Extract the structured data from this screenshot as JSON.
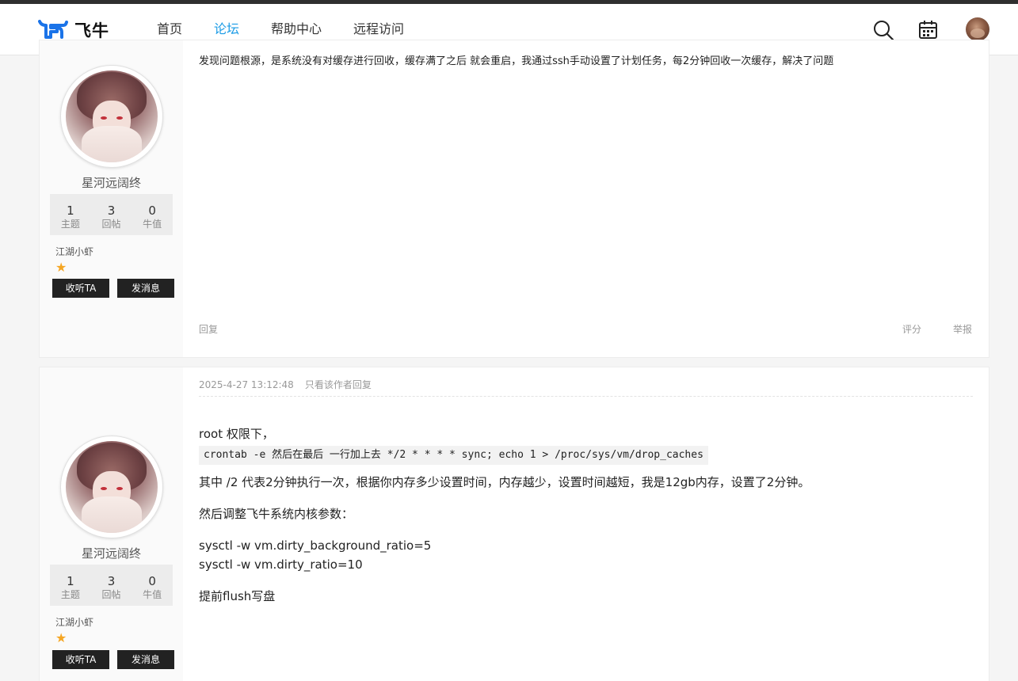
{
  "header": {
    "logo_text": "飞牛",
    "nav": [
      "首页",
      "论坛",
      "帮助中心",
      "远程访问"
    ],
    "active_nav": "论坛",
    "accent_color": "#1a9be6",
    "icons": [
      "search-icon",
      "calendar-icon",
      "user-avatar"
    ]
  },
  "posts": [
    {
      "author": {
        "name": "星河远阔终",
        "stats": [
          {
            "value": "1",
            "label": "主题"
          },
          {
            "value": "3",
            "label": "回帖"
          },
          {
            "value": "0",
            "label": "牛值"
          }
        ],
        "rank": "江湖小虾",
        "stars": "★",
        "follow_label": "收听TA",
        "message_label": "发消息"
      },
      "content": "发现问题根源，是系统没有对缓存进行回收，缓存满了之后 就会重启，我通过ssh手动设置了计划任务，每2分钟回收一次缓存，解决了问题",
      "footer": {
        "reply": "回复",
        "rate": "评分",
        "report": "举报"
      }
    },
    {
      "author": {
        "name": "星河远阔终",
        "stats": [
          {
            "value": "1",
            "label": "主题"
          },
          {
            "value": "3",
            "label": "回帖"
          },
          {
            "value": "0",
            "label": "牛值"
          }
        ],
        "rank": "江湖小虾",
        "stars": "★",
        "follow_label": "收听TA",
        "message_label": "发消息"
      },
      "meta": {
        "time": "2025-4-27 13:12:48",
        "only_author": "只看该作者",
        "reply": "回复"
      },
      "lines": {
        "l1": "root 权限下，",
        "code": "crontab -e 然后在最后 一行加上去 */2 * * * * sync; echo 1 > /proc/sys/vm/drop_caches",
        "l3": "其中 /2 代表2分钟执行一次，根据你内存多少设置时间，内存越少，设置时间越短，我是12gb内存，设置了2分钟。",
        "l4": "然后调整飞牛系统内核参数：",
        "l5": "sysctl -w vm.dirty_background_ratio=5",
        "l6": "sysctl -w vm.dirty_ratio=10",
        "l7": "提前flush写盘"
      }
    }
  ]
}
